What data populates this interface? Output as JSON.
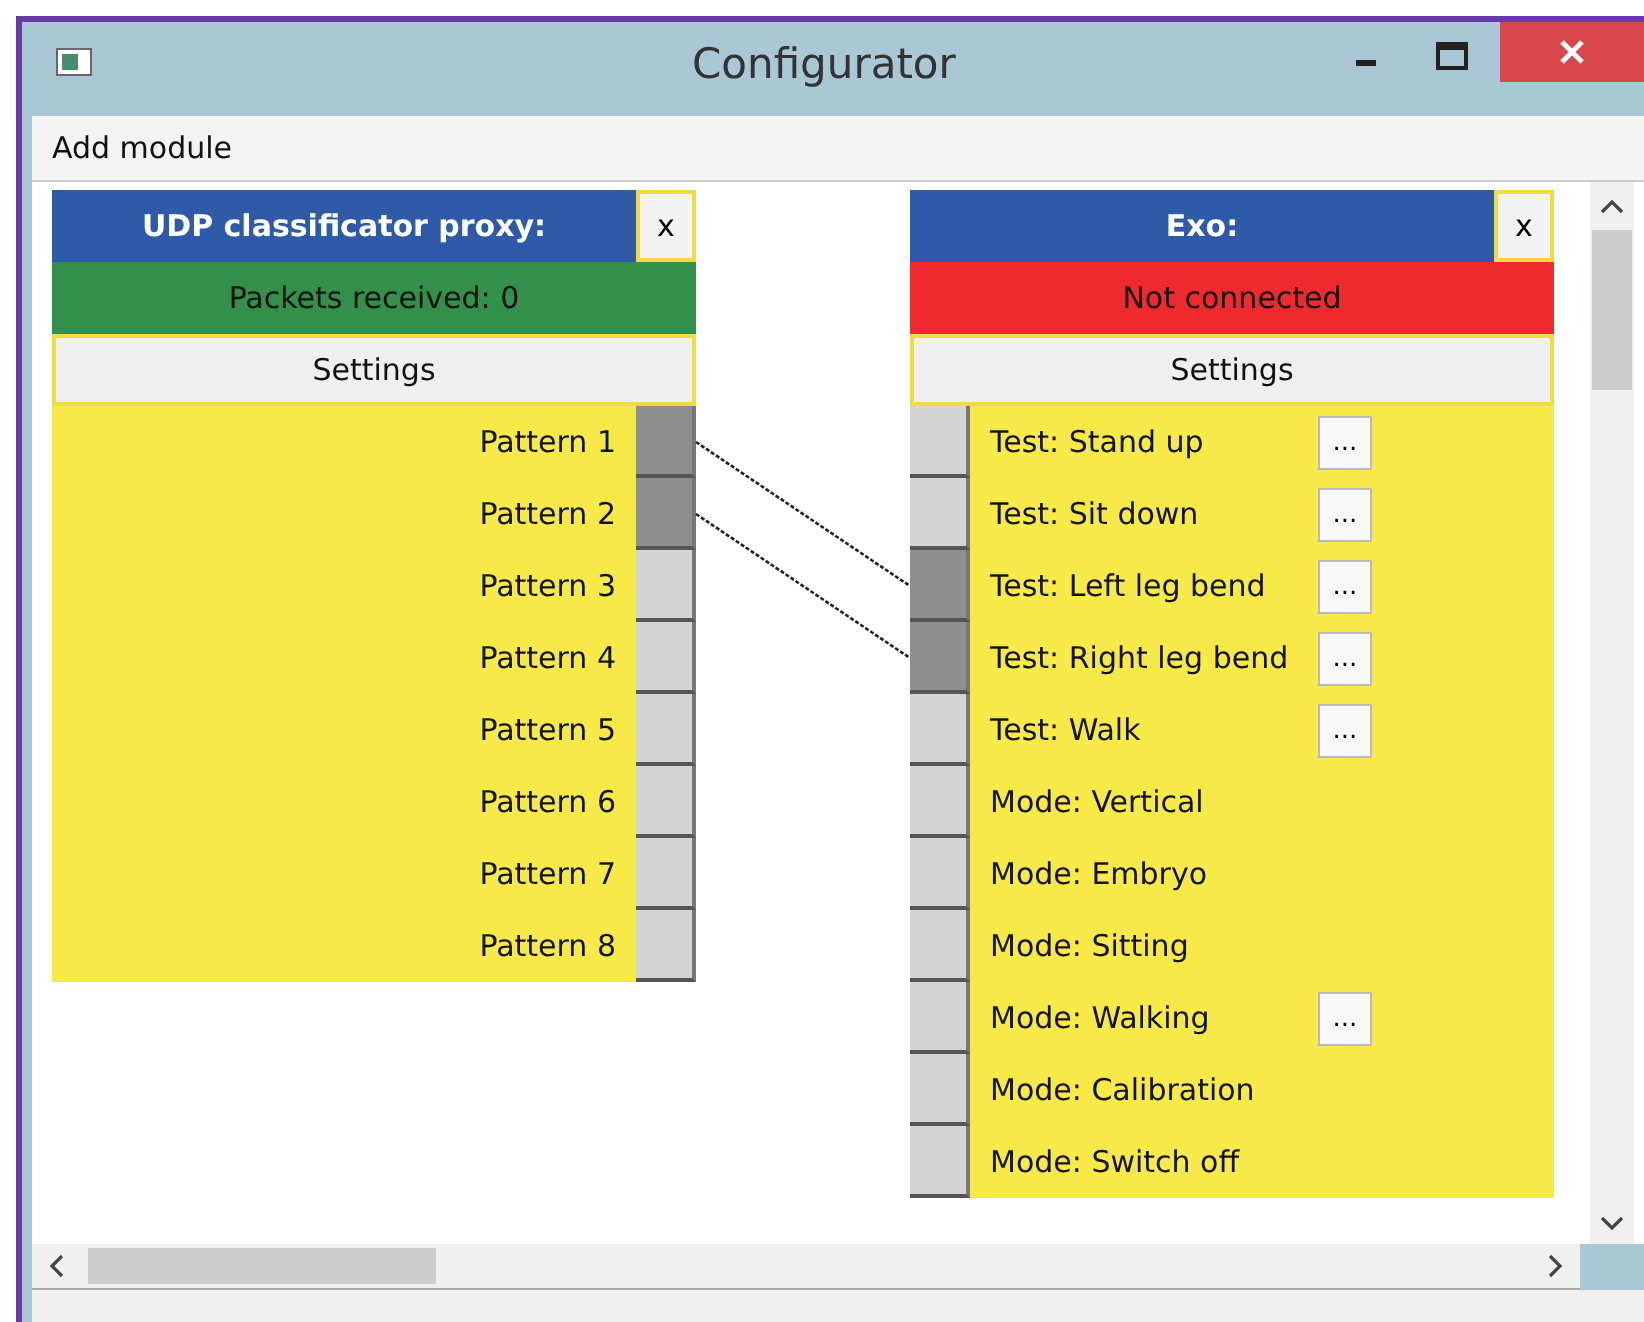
{
  "window": {
    "title": "Configurator"
  },
  "menu": [
    {
      "label": "Add module"
    }
  ],
  "modules": [
    {
      "kind": "source",
      "title": "UDP classificator proxy:",
      "close": "x",
      "status": {
        "text": "Packets received: 0",
        "color": "#32904a"
      },
      "settings": "Settings",
      "items": [
        {
          "label": "Pattern 1",
          "connected": true
        },
        {
          "label": "Pattern 2",
          "connected": true
        },
        {
          "label": "Pattern 3",
          "connected": false
        },
        {
          "label": "Pattern 4",
          "connected": false
        },
        {
          "label": "Pattern 5",
          "connected": false
        },
        {
          "label": "Pattern 6",
          "connected": false
        },
        {
          "label": "Pattern 7",
          "connected": false
        },
        {
          "label": "Pattern 8",
          "connected": false
        }
      ]
    },
    {
      "kind": "sink",
      "title": "Exo:",
      "close": "x",
      "status": {
        "text": "Not connected",
        "color": "#ee2a2f"
      },
      "settings": "Settings",
      "items": [
        {
          "label": "Test: Stand up",
          "connected": false,
          "options": "..."
        },
        {
          "label": "Test: Sit down",
          "connected": false,
          "options": "..."
        },
        {
          "label": "Test: Left leg bend",
          "connected": true,
          "options": "..."
        },
        {
          "label": "Test: Right leg bend",
          "connected": true,
          "options": "..."
        },
        {
          "label": "Test: Walk",
          "connected": false,
          "options": "..."
        },
        {
          "label": "Mode: Vertical",
          "connected": false
        },
        {
          "label": "Mode: Embryo",
          "connected": false
        },
        {
          "label": "Mode: Sitting",
          "connected": false
        },
        {
          "label": "Mode: Walking",
          "connected": false,
          "options": "..."
        },
        {
          "label": "Mode: Calibration",
          "connected": false
        },
        {
          "label": "Mode: Switch off",
          "connected": false
        }
      ]
    }
  ]
}
